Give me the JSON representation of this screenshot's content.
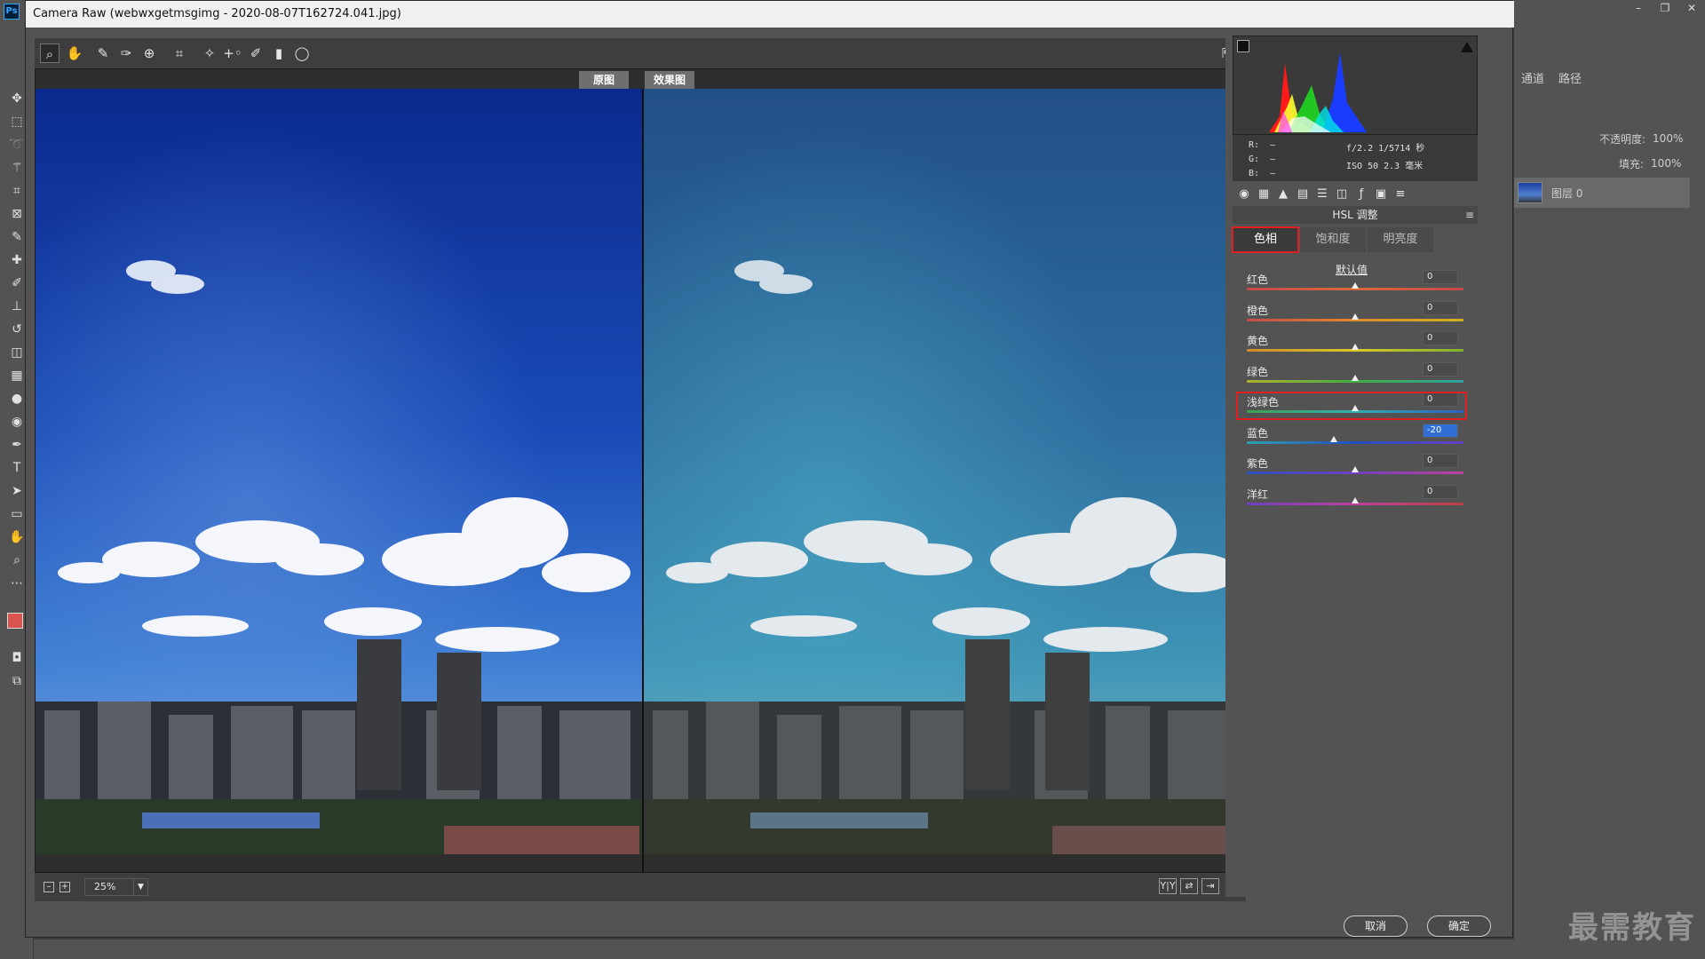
{
  "window": {
    "title": "Camera Raw (webwxgetmsgimg - 2020-08-07T162724.041.jpg)"
  },
  "ps": {
    "logo": "Ps",
    "panel_tabs": [
      "通道",
      "路径"
    ],
    "opacity_label": "不透明度:",
    "opacity_value": "100%",
    "fill_label": "填充:",
    "fill_value": "100%",
    "layer_name": "图层 0",
    "watermark": "最需教育"
  },
  "views": {
    "before_label": "原图",
    "after_label": "效果图"
  },
  "zoom": {
    "value": "25%"
  },
  "info": {
    "r": "R:",
    "g": "G:",
    "b": "B:",
    "rgb_value": "—",
    "aperture_shutter": "f/2.2  1/5714 秒",
    "iso_focal": "ISO 50  2.3 毫米"
  },
  "panel": {
    "title": "HSL 调整",
    "tabs": [
      "色相",
      "饱和度",
      "明亮度"
    ],
    "active_tab": 0,
    "defaults_label": "默认值",
    "sliders": [
      {
        "label": "红色",
        "value": "0",
        "fraction": 0.5
      },
      {
        "label": "橙色",
        "value": "0",
        "fraction": 0.5
      },
      {
        "label": "黄色",
        "value": "0",
        "fraction": 0.5
      },
      {
        "label": "绿色",
        "value": "0",
        "fraction": 0.5
      },
      {
        "label": "浅绿色",
        "value": "0",
        "fraction": 0.5
      },
      {
        "label": "蓝色",
        "value": "-20",
        "fraction": 0.4
      },
      {
        "label": "紫色",
        "value": "0",
        "fraction": 0.5
      },
      {
        "label": "洋红",
        "value": "0",
        "fraction": 0.5
      }
    ]
  },
  "buttons": {
    "cancel": "取消",
    "ok": "确定"
  },
  "colors": {
    "accent_red": "#e02020",
    "selected_blue": "#2f6fd6"
  }
}
